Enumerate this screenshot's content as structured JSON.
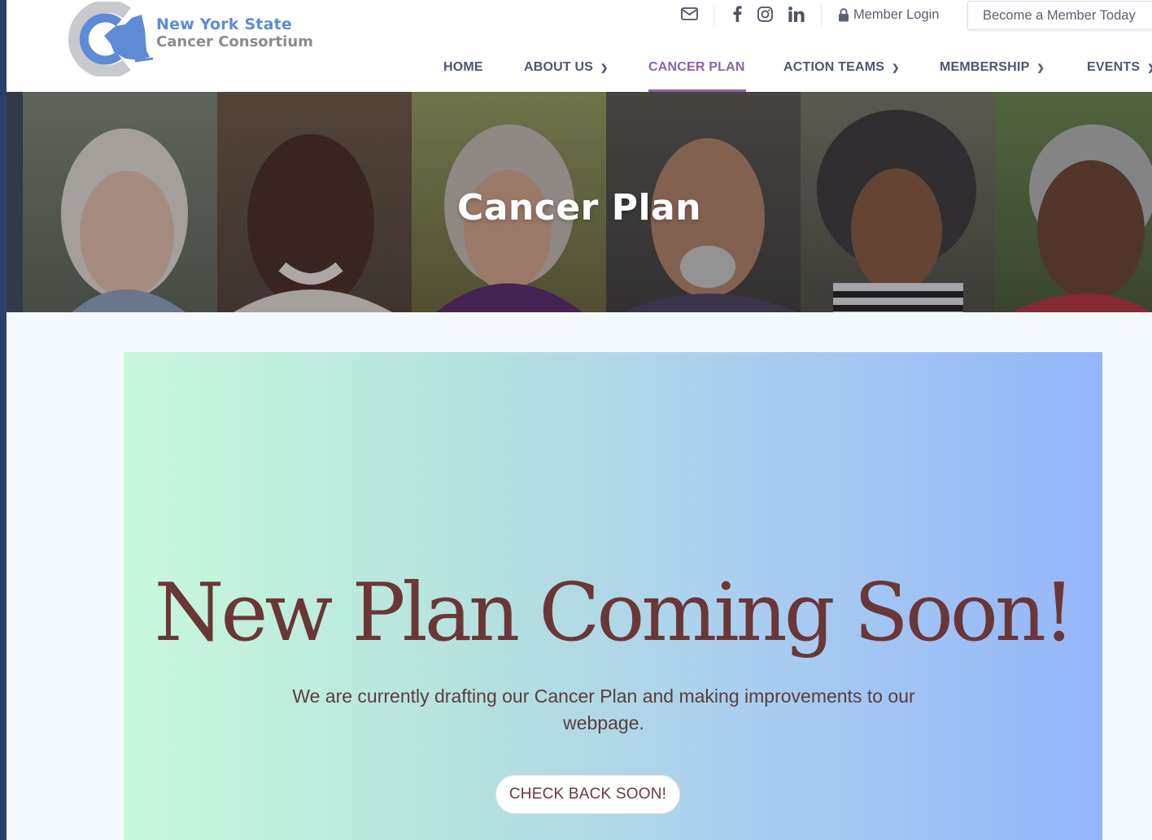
{
  "logo": {
    "line1": "New York State",
    "line2": "Cancer Consortium"
  },
  "topbar": {
    "icons": [
      "email-icon",
      "facebook-icon",
      "instagram-icon",
      "linkedin-icon"
    ],
    "member_login_label": "Member Login",
    "become_member_label": "Become a Member Today"
  },
  "nav": {
    "items": [
      {
        "label": "HOME",
        "has_dropdown": false
      },
      {
        "label": "ABOUT US",
        "has_dropdown": true
      },
      {
        "label": "CANCER PLAN",
        "has_dropdown": false,
        "active": true
      },
      {
        "label": "ACTION TEAMS",
        "has_dropdown": true
      },
      {
        "label": "MEMBERSHIP",
        "has_dropdown": true
      },
      {
        "label": "EVENTS",
        "has_dropdown": true
      }
    ]
  },
  "hero": {
    "title": "Cancer Plan"
  },
  "main": {
    "headline": "New Plan Coming Soon!",
    "subtext": "We are currently drafting our Cancer Plan and making improvements to our webpage.",
    "cta_label": "CHECK BACK SOON!"
  },
  "colors": {
    "accent_purple": "#8a64a8",
    "nav_text": "#4b5870",
    "logo_blue": "#5f8ad6",
    "headline_brown": "#6b3636",
    "gradient_start": "#c8f8dc",
    "gradient_end": "#94b6fa"
  }
}
